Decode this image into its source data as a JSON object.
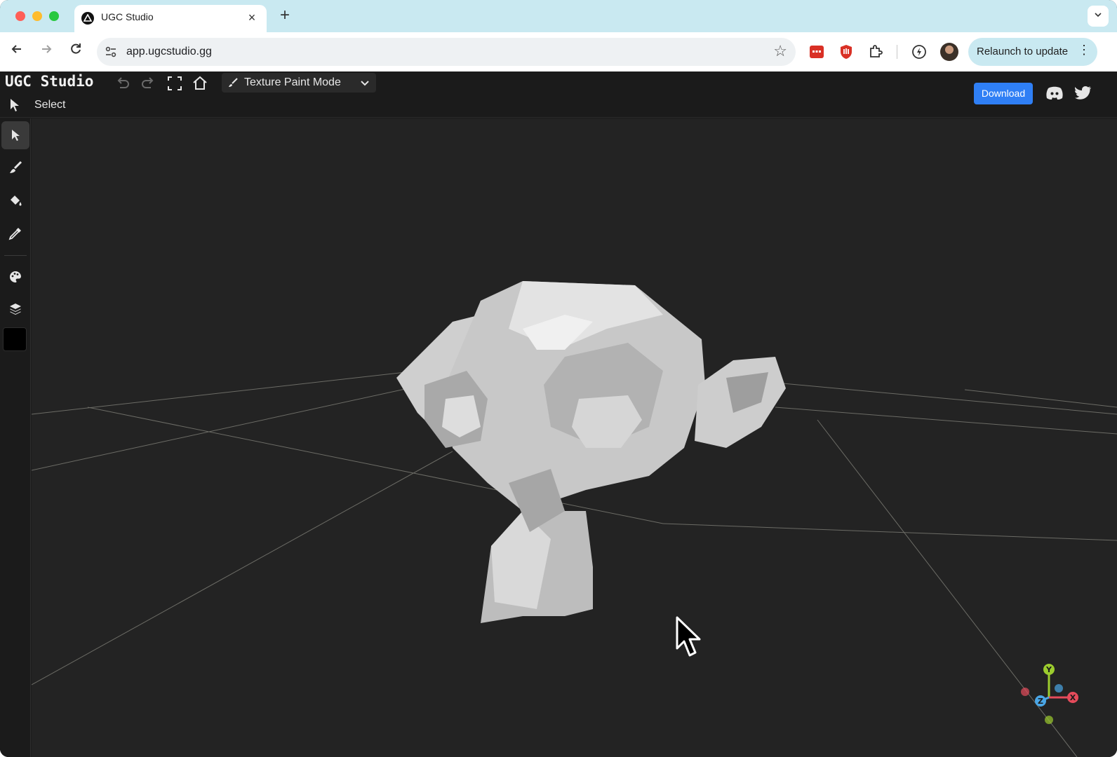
{
  "browser": {
    "tab_title": "UGC Studio",
    "url": "app.ugcstudio.gg",
    "relaunch_label": "Relaunch to update"
  },
  "app": {
    "brand": "UGC Studio",
    "mode_label": "Texture Paint Mode",
    "tool_label": "Select",
    "download_label": "Download",
    "current_color": "#000000",
    "accent_color": "#2f7ff5"
  },
  "sidebar_tools": [
    "select-tool",
    "brush-tool",
    "fill-bucket-tool",
    "eyedropper-tool",
    "palette-tool",
    "layers-tool"
  ],
  "gizmo": {
    "axis_y": "Y",
    "axis_z": "Z",
    "axis_x": "X"
  }
}
